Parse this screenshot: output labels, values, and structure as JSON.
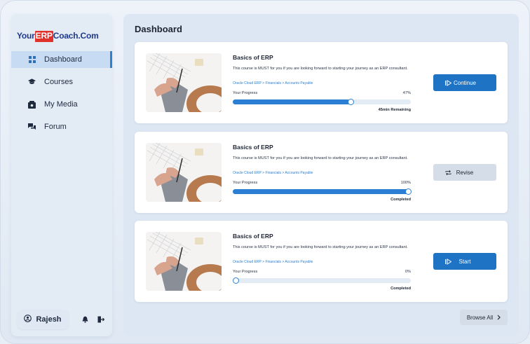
{
  "logo": {
    "part1": "Your",
    "part2": "ERP",
    "part3": "Coach.Com"
  },
  "sidebar": {
    "items": [
      {
        "label": "Dashboard",
        "icon": "grid-icon",
        "active": true
      },
      {
        "label": "Courses",
        "icon": "graduation-cap-icon",
        "active": false
      },
      {
        "label": "My Media",
        "icon": "media-folder-icon",
        "active": false
      },
      {
        "label": "Forum",
        "icon": "chat-bubbles-icon",
        "active": false
      }
    ],
    "user": {
      "name": "Rajesh",
      "icon": "user-circle-icon"
    },
    "bell_icon": "bell-icon",
    "logout_icon": "logout-icon"
  },
  "page": {
    "title": "Dashboard"
  },
  "courses": [
    {
      "title": "Basics of ERP",
      "description": "This  course is MUST for you if you are looking forward to starting your journey as an ERP consultant.",
      "breadcrumb": "Oracle Cloud ERP > Financials > Accounts Payable",
      "progress_label": "Your Progress",
      "progress_text": "47%",
      "progress_value": 0.66,
      "status": "45min Remaining",
      "button": {
        "label": "Continue",
        "icon": "play-icon",
        "style": "primary"
      }
    },
    {
      "title": "Basics of ERP",
      "description": "This  course is MUST for you if you are looking forward to starting your journey as an ERP consultant.",
      "breadcrumb": "Oracle Cloud ERP > Financials > Accounts Payable",
      "progress_label": "Your Progress",
      "progress_text": "100%",
      "progress_value": 1.0,
      "status": "Completed",
      "button": {
        "label": "Revise",
        "icon": "repeat-icon",
        "style": "secondary"
      }
    },
    {
      "title": "Basics of ERP",
      "description": "This  course is MUST for you if you are looking forward to starting your journey as an ERP consultant.",
      "breadcrumb": "Oracle Cloud ERP > Financials > Accounts Payable",
      "progress_label": "Your Progress",
      "progress_text": "0%",
      "progress_value": 0.0,
      "status": "Completed",
      "button": {
        "label": "Start",
        "icon": "play-icon",
        "style": "primary"
      }
    }
  ],
  "browse_all": {
    "label": "Browse All",
    "icon": "chevron-right-icon"
  },
  "colors": {
    "accent": "#1f73c4",
    "progress": "#2a7fd4",
    "logo_red": "#e0312b",
    "logo_blue": "#1f3a8a"
  }
}
